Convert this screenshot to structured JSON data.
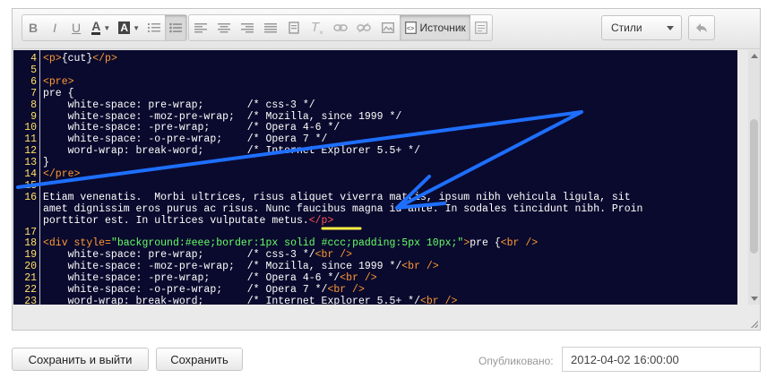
{
  "toolbar": {
    "bold_label": "B",
    "italic_label": "I",
    "underline_label": "U",
    "text_color_label": "A",
    "bg_color_label": "A",
    "source_label": "Источник",
    "styles_label": "Стили"
  },
  "icons": [
    "bold-icon",
    "italic-icon",
    "underline-icon",
    "text-color-icon",
    "bg-color-icon",
    "numbered-list-icon",
    "bullet-list-icon",
    "align-left-icon",
    "align-center-icon",
    "align-right-icon",
    "align-justify-icon",
    "paste-word-icon",
    "remove-format-icon",
    "link-icon",
    "unlink-icon",
    "image-icon",
    "source-icon",
    "preview-icon",
    "undo-icon"
  ],
  "code_lines": [
    {
      "n": "4",
      "html": "<span class='tag'>&lt;p&gt;</span>{cut}<span class='tag'>&lt;/p&gt;</span>"
    },
    {
      "n": "5",
      "html": ""
    },
    {
      "n": "6",
      "html": "<span class='tag'>&lt;pre&gt;</span>"
    },
    {
      "n": "7",
      "html": "pre {"
    },
    {
      "n": "8",
      "html": "    white-space: pre-wrap;       /* css-3 */"
    },
    {
      "n": "9",
      "html": "    white-space: -moz-pre-wrap;  /* Mozilla, since 1999 */"
    },
    {
      "n": "10",
      "html": "    white-space: -pre-wrap;      /* Opera 4-6 */"
    },
    {
      "n": "11",
      "html": "    white-space: -o-pre-wrap;    /* Opera 7 */"
    },
    {
      "n": "12",
      "html": "    word-wrap: break-word;       /* Internet Explorer 5.5+ */"
    },
    {
      "n": "13",
      "html": "}"
    },
    {
      "n": "14",
      "html": "<span class='tag'>&lt;/pre&gt;</span>"
    },
    {
      "n": "15",
      "html": ""
    },
    {
      "n": "16",
      "html": "Etiam venenatis.  Morbi ultrices, risus aliquet viverra mattis, ipsum nibh vehicula ligula, sit"
    },
    {
      "n": "",
      "html": "amet dignissim eros purus ac risus. Nunc faucibus magna id ante. In sodales tincidunt nibh. Proin"
    },
    {
      "n": "",
      "html": "porttitor est. In ultrices vulputate metus.<span class='tag red'>&lt;/p&gt;</span>"
    },
    {
      "n": "17",
      "html": ""
    },
    {
      "n": "18",
      "html": "<span class='tag'>&lt;div</span> <span class='tag'>style=</span><span class='str'>\"background:#eee;border:1px solid #ccc;padding:5px 10px;\"</span><span class='tag'>&gt;</span>pre {<span class='tag'>&lt;br /&gt;</span>"
    },
    {
      "n": "19",
      "html": "    white-space: pre-wrap;       /* css-3 */<span class='tag'>&lt;br /&gt;</span>"
    },
    {
      "n": "20",
      "html": "    white-space: -moz-pre-wrap;  /* Mozilla, since 1999 */<span class='tag'>&lt;br /&gt;</span>"
    },
    {
      "n": "21",
      "html": "    white-space: -pre-wrap;      /* Opera 4-6 */<span class='tag'>&lt;br /&gt;</span>"
    },
    {
      "n": "22",
      "html": "    white-space: -o-pre-wrap;    /* Opera 7 */<span class='tag'>&lt;br /&gt;</span>"
    },
    {
      "n": "23",
      "html": "    word-wrap: break-word;       /* Internet Explorer 5.5+ */<span class='tag'>&lt;br /&gt;</span>"
    }
  ],
  "buttons": {
    "save_exit": "Сохранить и выйти",
    "save": "Сохранить"
  },
  "published": {
    "label": "Опубликовано:",
    "value": "2012-04-02 16:00:00"
  },
  "colors": {
    "editor_bg": "#0a0a2e",
    "line_number": "#ffe066",
    "tag": "#ff9933",
    "string": "#66ff66",
    "annotation_arrow": "#1e6fff",
    "annotation_underline": "#ffee44"
  }
}
